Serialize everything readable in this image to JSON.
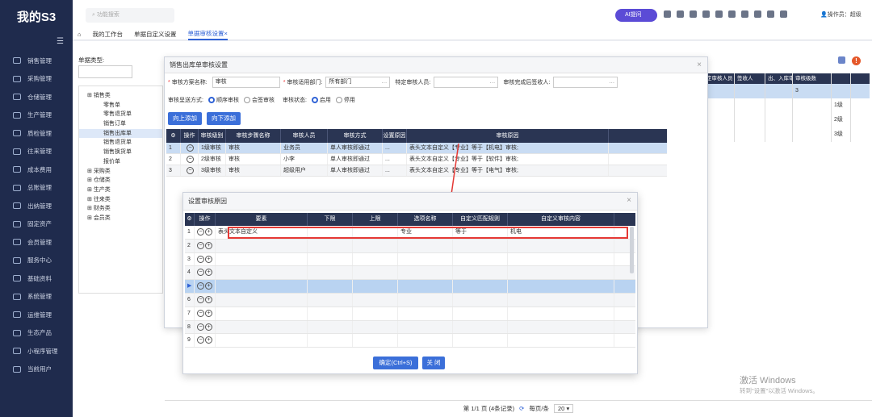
{
  "sidebar": {
    "logo": "我的S3",
    "items": [
      "销售管理",
      "采购管理",
      "仓储管理",
      "生产管理",
      "质检管理",
      "往来管理",
      "成本费用",
      "总账管理",
      "出纳管理",
      "固定资产",
      "会员管理",
      "服务中心",
      "基础资料",
      "系统管理",
      "运维管理",
      "生态产品",
      "小程序管理",
      "当前用户"
    ]
  },
  "topbar": {
    "search_placeholder": "功能搜索",
    "ai_label": "AI提问",
    "user_label": "操作员：超级"
  },
  "tabs": [
    "我的工作台",
    "单据自定义设置",
    "单据审核设置"
  ],
  "tab_close": "×",
  "left": {
    "doc_type_label": "单据类型:",
    "tree": [
      {
        "type": "cat",
        "label": "销售类"
      },
      {
        "type": "leaf",
        "label": "零售单"
      },
      {
        "type": "leaf",
        "label": "零售退货单"
      },
      {
        "type": "leaf",
        "label": "销售订单"
      },
      {
        "type": "leaf",
        "label": "销售出库单",
        "selected": true
      },
      {
        "type": "leaf",
        "label": "销售退货单"
      },
      {
        "type": "leaf",
        "label": "销售换货单"
      },
      {
        "type": "leaf",
        "label": "报价单"
      },
      {
        "type": "cat",
        "label": "采购类"
      },
      {
        "type": "cat",
        "label": "仓储类"
      },
      {
        "type": "cat",
        "label": "生产类"
      },
      {
        "type": "cat",
        "label": "往来类"
      },
      {
        "type": "cat",
        "label": "财务类"
      },
      {
        "type": "cat",
        "label": "会员类"
      }
    ]
  },
  "bgtable": {
    "headers": [
      "定审核人员",
      "签收人",
      "出、入库审核",
      "审核级数",
      ""
    ],
    "rows": [
      [
        "",
        "",
        "",
        "3",
        ""
      ],
      [
        "",
        "",
        "",
        "",
        "1级"
      ],
      [
        "",
        "",
        "",
        "",
        "2级"
      ],
      [
        "",
        "",
        "",
        "",
        "3级"
      ]
    ]
  },
  "pager": {
    "text": "第 1/1 页 (4条记录)",
    "per_page": "每页/条",
    "size": "20"
  },
  "watermark": {
    "title": "激活 Windows",
    "sub": "转到\"设置\"以激活 Windows。"
  },
  "dlg1": {
    "title": "销售出库单审核设置",
    "close": "×",
    "f_scheme_label": "审核方案名称:",
    "f_scheme_value": "审核",
    "f_dept_label": "审核适用部门:",
    "f_dept_value": "所有部门",
    "f_user_label": "特定审核人员:",
    "f_sign_label": "审核完成后签收人:",
    "f_mode_label": "审核呈送方式:",
    "f_mode_opt1": "顺序审核",
    "f_mode_opt2": "会签审核",
    "f_status_label": "审核状态:",
    "f_status_opt1": "启用",
    "f_status_opt2": "停用",
    "btn_up": "向上添加",
    "btn_down": "向下添加",
    "headers": [
      "操作",
      "审核级别",
      "审核步骤名称",
      "审核人员",
      "审核方式",
      "设置原因",
      "审核原因"
    ],
    "rows": [
      [
        "1",
        "1级审核",
        "审核",
        "业务员",
        "单人审核即通过",
        "...",
        "表头文本自定义【专业】等于【机电】审核;"
      ],
      [
        "2",
        "2级审核",
        "审核",
        "小李",
        "单人审核即通过",
        "...",
        "表头文本自定义【专业】等于【软件】审核;"
      ],
      [
        "3",
        "3级审核",
        "审核",
        "超级用户",
        "单人审核即通过",
        "...",
        "表头文本自定义【专业】等于【电气】审核;"
      ]
    ]
  },
  "dlg2": {
    "title": "设置审核原因",
    "close": "×",
    "headers": [
      "操作",
      "要素",
      "下限",
      "上限",
      "选项名称",
      "自定义匹配规则",
      "自定义审核内容"
    ],
    "row1": [
      "1",
      "表头文本自定义",
      "",
      "",
      "专业",
      "等于",
      "机电"
    ],
    "row_nums": [
      "2",
      "3",
      "4",
      "",
      "6",
      "7",
      "8",
      "9"
    ],
    "ok": "确定(Ctrl+S)",
    "cancel": "关 闭"
  }
}
